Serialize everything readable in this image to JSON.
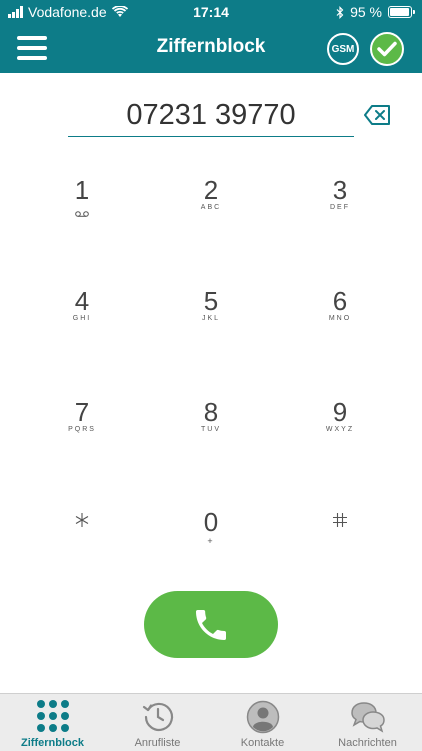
{
  "status": {
    "carrier": "Vodafone.de",
    "time": "17:14",
    "battery": "95 %",
    "battery_level": 0.95
  },
  "header": {
    "title": "Ziffernblock",
    "gsm_label": "GSM"
  },
  "dialer": {
    "number": "07231 39770"
  },
  "keypad": {
    "k1": {
      "digit": "1",
      "letters": ""
    },
    "k2": {
      "digit": "2",
      "letters": "ABC"
    },
    "k3": {
      "digit": "3",
      "letters": "DEF"
    },
    "k4": {
      "digit": "4",
      "letters": "GHI"
    },
    "k5": {
      "digit": "5",
      "letters": "JKL"
    },
    "k6": {
      "digit": "6",
      "letters": "MNO"
    },
    "k7": {
      "digit": "7",
      "letters": "PQRS"
    },
    "k8": {
      "digit": "8",
      "letters": "TUV"
    },
    "k9": {
      "digit": "9",
      "letters": "WXYZ"
    },
    "kstar": {
      "digit": "*",
      "letters": ""
    },
    "k0": {
      "digit": "0",
      "letters": "+"
    },
    "khash": {
      "digit": "#",
      "letters": ""
    }
  },
  "tabs": [
    {
      "label": "Ziffernblock",
      "active": true
    },
    {
      "label": "Anrufliste",
      "active": false
    },
    {
      "label": "Kontakte",
      "active": false
    },
    {
      "label": "Nachrichten",
      "active": false
    }
  ],
  "colors": {
    "primary": "#0d7c88",
    "call": "#5cb947"
  }
}
